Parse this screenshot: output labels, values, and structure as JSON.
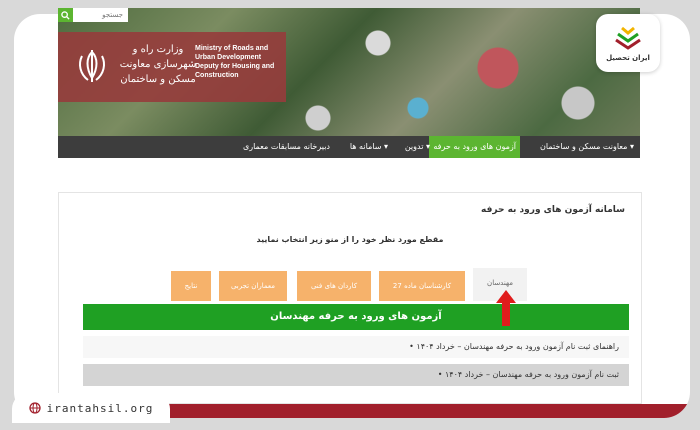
{
  "header": {
    "search_placeholder": "جستجو",
    "brand_fa": "وزارت راه و شهرسازی معاونت مسکن و ساختمان",
    "brand_en": "Ministry of Roads and Urban Development Deputy for Housing and Construction"
  },
  "nav": {
    "items": [
      {
        "label": "معاونت مسکن و ساختمان"
      },
      {
        "label": "آزمون های ورود به حرفه"
      },
      {
        "label": "تدوین"
      },
      {
        "label": "سامانه ها"
      },
      {
        "label": "دبیرخانه مسابقات معماری"
      }
    ]
  },
  "main": {
    "title": "سامانه آزمون های ورود به حرفه",
    "subtitle": "مقطع مورد نظر خود را از منو زیر انتخاب نمایید",
    "tabs": [
      {
        "label": "مهندسان"
      },
      {
        "label": "کارشناسان ماده 27"
      },
      {
        "label": "کاردان های فنی"
      },
      {
        "label": "معماران تجربی"
      },
      {
        "label": "نتایج"
      }
    ],
    "section_title": "آزمون های ورود به حرفه مهندسان",
    "list": [
      {
        "text": "• راهنمای ثبت نام آزمون ورود به حرفه مهندسان – خرداد ۱۴۰۴"
      },
      {
        "text": "• ثبت نام آزمون ورود به حرفه مهندسان – خرداد ۱۴۰۴"
      }
    ]
  },
  "logo": {
    "name": "ایران تحصیل"
  },
  "footer": {
    "url": "irantahsil.org"
  },
  "colors": {
    "green": "#5cb531",
    "dark_green": "#1fa023",
    "tab_orange": "#f6b26b",
    "nav": "#3d3d3d",
    "brand": "#963c3c",
    "accent_red": "#a11f2b"
  }
}
